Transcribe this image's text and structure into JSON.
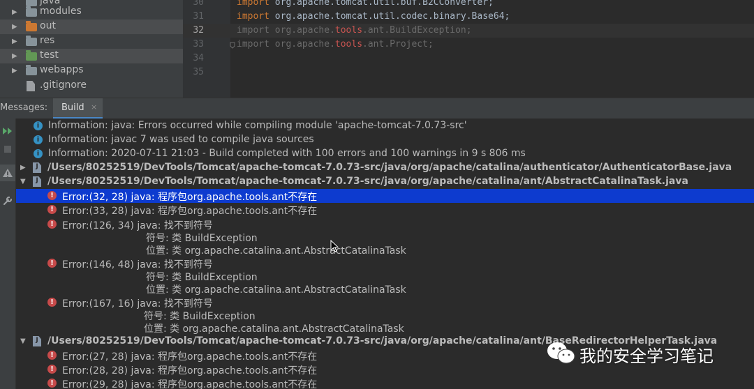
{
  "project_tree": {
    "items": [
      {
        "label": "java",
        "type": "folder",
        "color": "#87939a"
      },
      {
        "label": "modules",
        "type": "folder",
        "color": "#87939a",
        "arrow": "▶"
      },
      {
        "label": "out",
        "type": "folder",
        "color": "#cc7832",
        "arrow": "▶",
        "selected": true
      },
      {
        "label": "res",
        "type": "folder",
        "color": "#87939a",
        "arrow": "▶"
      },
      {
        "label": "test",
        "type": "folder",
        "color": "#629755",
        "arrow": "▶",
        "selected": true
      },
      {
        "label": "webapps",
        "type": "folder",
        "color": "#87939a",
        "arrow": "▶"
      },
      {
        "label": ".gitignore",
        "type": "file",
        "icon": "gitignore-file-icon"
      }
    ]
  },
  "editor": {
    "lines": [
      {
        "num": "30",
        "kw": "import",
        "pkg": "org.apache.tomcat.util.buf.B2CConverter;",
        "dim": false
      },
      {
        "num": "31",
        "kw": "import",
        "pkg": "org.apache.tomcat.util.codec.binary.Base64;",
        "dim": false
      },
      {
        "num": "32",
        "kw": "import",
        "pre": "org.apache.",
        "hl": "tools",
        "post": ".ant.BuildException;",
        "dim": true,
        "current": true
      },
      {
        "num": "33",
        "kw": "import",
        "pre": "org.apache.",
        "hl": "tools",
        "post": ".ant.Project;",
        "dim": true
      },
      {
        "num": "34"
      },
      {
        "num": "35"
      }
    ]
  },
  "messages_panel": {
    "title": "Messages:",
    "tab_label": "Build",
    "close_glyph": "×"
  },
  "toolbar": {
    "icons": [
      "rerun-icon",
      "stop-icon",
      "warning-filter-icon",
      "settings-wrench-icon"
    ]
  },
  "messages": {
    "info": [
      "Information: java: Errors occurred while compiling module 'apache-tomcat-7.0.73-src'",
      "Information: javac 7 was used to compile java sources",
      "Information: 2020-07-11 21:03 - Build completed with 100 errors and 100 warnings in 9 s 806 ms"
    ],
    "file1": "/Users/80252519/DevTools/Tomcat/apache-tomcat-7.0.73-src/java/org/apache/catalina/authenticator/AuthenticatorBase.java",
    "file2": "/Users/80252519/DevTools/Tomcat/apache-tomcat-7.0.73-src/java/org/apache/catalina/ant/AbstractCatalinaTask.java",
    "file2_errors": [
      {
        "text": "Error:(32, 28)  java: 程序包org.apache.tools.ant不存在"
      },
      {
        "text": "Error:(33, 28)  java: 程序包org.apache.tools.ant不存在"
      },
      {
        "text": "Error:(126, 34)  java: 找不到符号",
        "symbol": "符号:   类 BuildException",
        "location": "位置: 类 org.apache.catalina.ant.AbstractCatalinaTask"
      },
      {
        "text": "Error:(146, 48)  java: 找不到符号",
        "symbol": "符号:   类 BuildException",
        "location": "位置: 类 org.apache.catalina.ant.AbstractCatalinaTask"
      },
      {
        "text": "Error:(167, 16)  java: 找不到符号",
        "symbol": "符号:   类 BuildException",
        "location": "位置: 类 org.apache.catalina.ant.AbstractCatalinaTask"
      }
    ],
    "file3": "/Users/80252519/DevTools/Tomcat/apache-tomcat-7.0.73-src/java/org/apache/catalina/ant/BaseRedirectorHelperTask.java",
    "file3_errors": [
      {
        "text": "Error:(27, 28)  java: 程序包org.apache.tools.ant不存在"
      },
      {
        "text": "Error:(28, 28)  java: 程序包org.apache.tools.ant不存在"
      },
      {
        "text": "Error:(29, 28)  java: 程序包org.apache.tools.ant不存在"
      }
    ]
  },
  "watermark": {
    "text": "我的安全学习笔记"
  },
  "colors": {
    "selection": "#0d3bcf",
    "info": "#3592c4",
    "error": "#c74a4a"
  }
}
